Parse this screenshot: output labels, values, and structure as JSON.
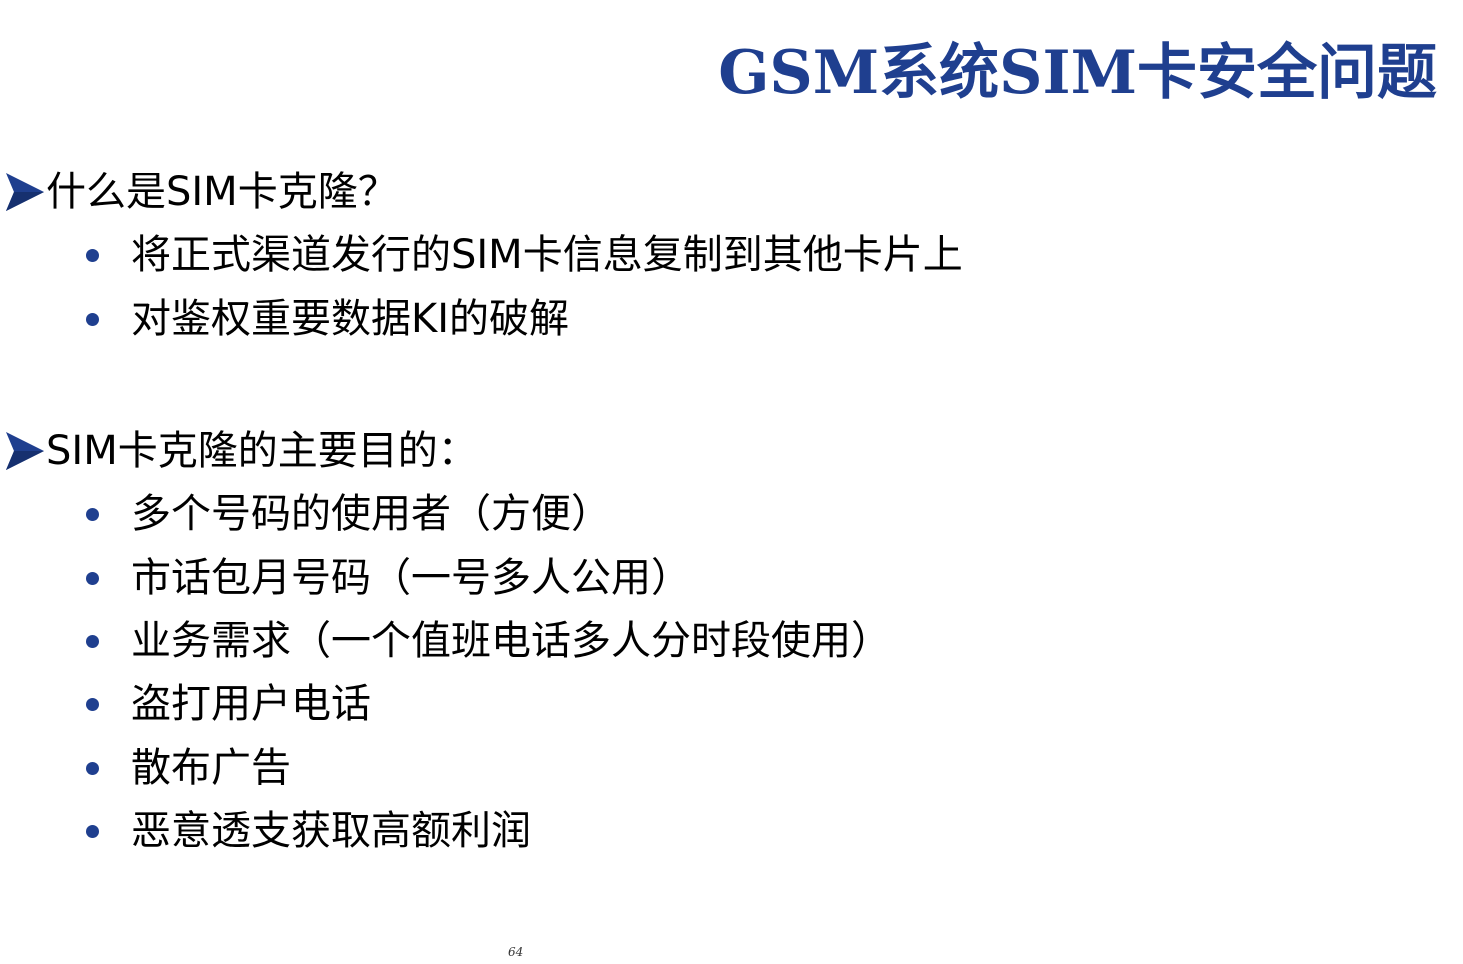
{
  "slide": {
    "title": "GSM系统SIM卡安全问题",
    "sections": [
      {
        "header": "什么是SIM卡克隆？",
        "bullets": [
          "将正式渠道发行的SIM卡信息复制到其他卡片上",
          "对鉴权重要数据KI的破解"
        ]
      },
      {
        "header": "SIM卡克隆的主要目的：",
        "bullets": [
          "多个号码的使用者（方便）",
          "市话包月号码（一号多人公用）",
          "业务需求（一个值班电话多人分时段使用）",
          "盗打用户电话",
          "散布广告",
          "恶意透支获取高额利润"
        ]
      }
    ],
    "page_number": "64"
  },
  "colors": {
    "title": "#1f3f8f",
    "arrow": "#1f3f8f",
    "bullet_dot": "#1f3f8f",
    "body_text": "#000000",
    "background": "#ffffff"
  },
  "icons": {
    "section_marker": "arrow-right-icon",
    "bullet": "bullet-dot-icon"
  }
}
